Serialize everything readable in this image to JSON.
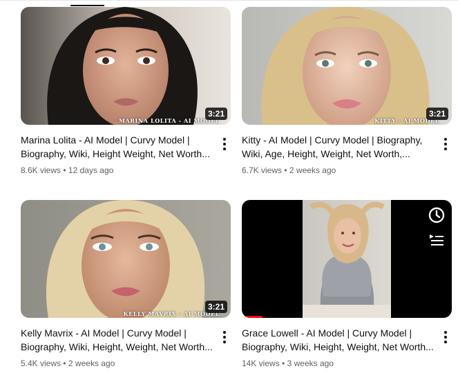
{
  "videos": [
    {
      "title": "Marina Lolita - AI Model | Curvy Model | Biography, Wiki, Height Weight, Net Worth...",
      "views": "8.6K views",
      "age": "12 days ago",
      "duration": "3:21",
      "overlay": "MARINA LOLITA - AI MODEL"
    },
    {
      "title": "Kitty - AI Model | Curvy Model | Biography, Wiki, Age, Height, Weight, Net Worth,...",
      "views": "6.7K views",
      "age": "2 weeks ago",
      "duration": "3:21",
      "overlay": "KITTY - AI MODEL"
    },
    {
      "title": "Kelly Mavrix - AI Model | Curvy Model | Biography, Wiki, Height, Weight, Net Worth...",
      "views": "5.4K views",
      "age": "2 weeks ago",
      "duration": "3:21",
      "overlay": "KELLY MAVRIX - AI MODEL"
    },
    {
      "title": "Grace Lowell - AI Model | Curvy Model | Biography, Wiki, Height, Weight, Net Worth...",
      "views": "14K views",
      "age": "3 weeks ago",
      "hover_icons": [
        "clock-icon",
        "add-to-queue-icon"
      ],
      "progress": 0.1
    }
  ],
  "separator": "•",
  "colors": {
    "meta_text": "#606060",
    "progress": "#ff0000"
  }
}
